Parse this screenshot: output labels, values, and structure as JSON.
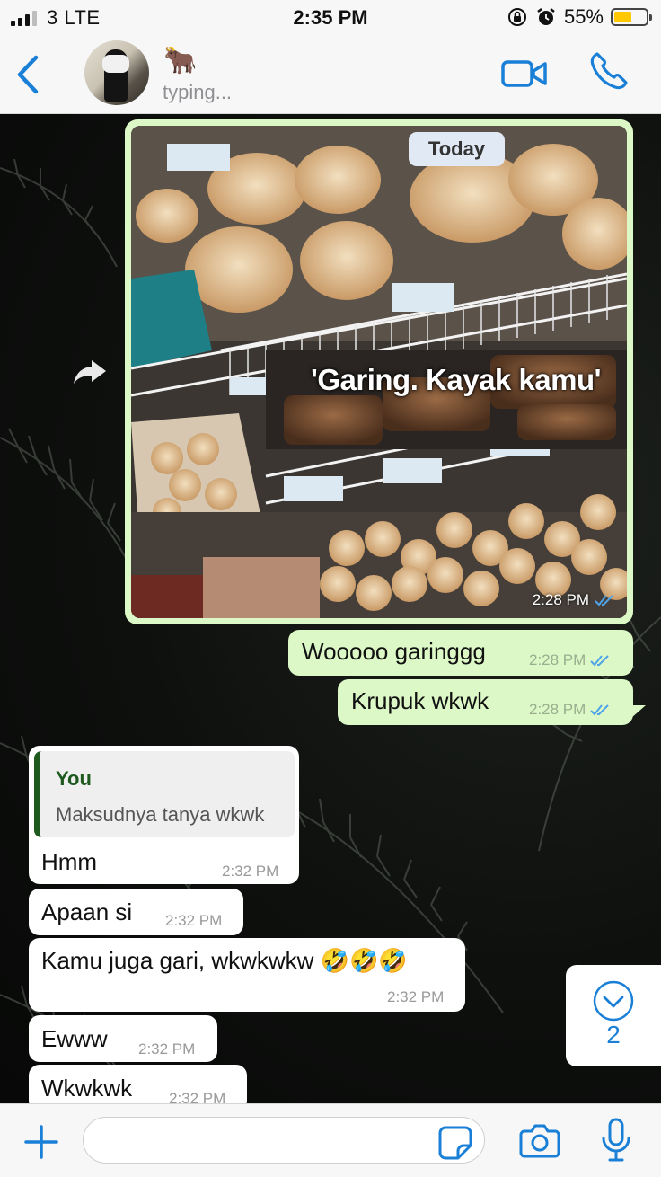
{
  "status_bar": {
    "carrier": "3  LTE",
    "time": "2:35 PM",
    "battery_percent": "55%",
    "battery_level": 0.55,
    "signal_bars": 3,
    "icons": [
      "orientation-lock-icon",
      "alarm-icon",
      "battery-icon"
    ]
  },
  "header": {
    "contact_name": "🐂",
    "contact_status": "typing...",
    "icons": [
      "back-icon",
      "video-call-icon",
      "phone-icon"
    ]
  },
  "chat": {
    "day_label": "Today",
    "image_message": {
      "caption_in_image": "'Garing. Kayak kamu'",
      "time": "2:28 PM"
    },
    "messages": [
      {
        "direction": "out",
        "text": "Wooooo garinggg",
        "time": "2:28 PM"
      },
      {
        "direction": "out",
        "text": "Krupuk wkwk",
        "time": "2:28 PM"
      },
      {
        "direction": "in",
        "quote_author": "You",
        "quote_text": "Maksudnya tanya wkwk",
        "text": "Hmm",
        "time": "2:32 PM"
      },
      {
        "direction": "in",
        "text": "Apaan si",
        "time": "2:32 PM"
      },
      {
        "direction": "in",
        "text": "Kamu juga gari, wkwkwkw 🤣🤣🤣",
        "time": "2:32 PM"
      },
      {
        "direction": "in",
        "text": "Ewww",
        "time": "2:32 PM"
      },
      {
        "direction": "in",
        "text": "Wkwkwk",
        "time": "2:32 PM"
      }
    ],
    "unread_count": "2"
  },
  "input_bar": {
    "placeholder": "",
    "icons": [
      "plus-icon",
      "sticker-icon",
      "camera-icon",
      "microphone-icon"
    ]
  },
  "colors": {
    "accent": "#1a7fd6",
    "outgoing_bubble": "#dcf8c6",
    "incoming_bubble": "#ffffff",
    "read_ticks": "#4fa3e8"
  }
}
